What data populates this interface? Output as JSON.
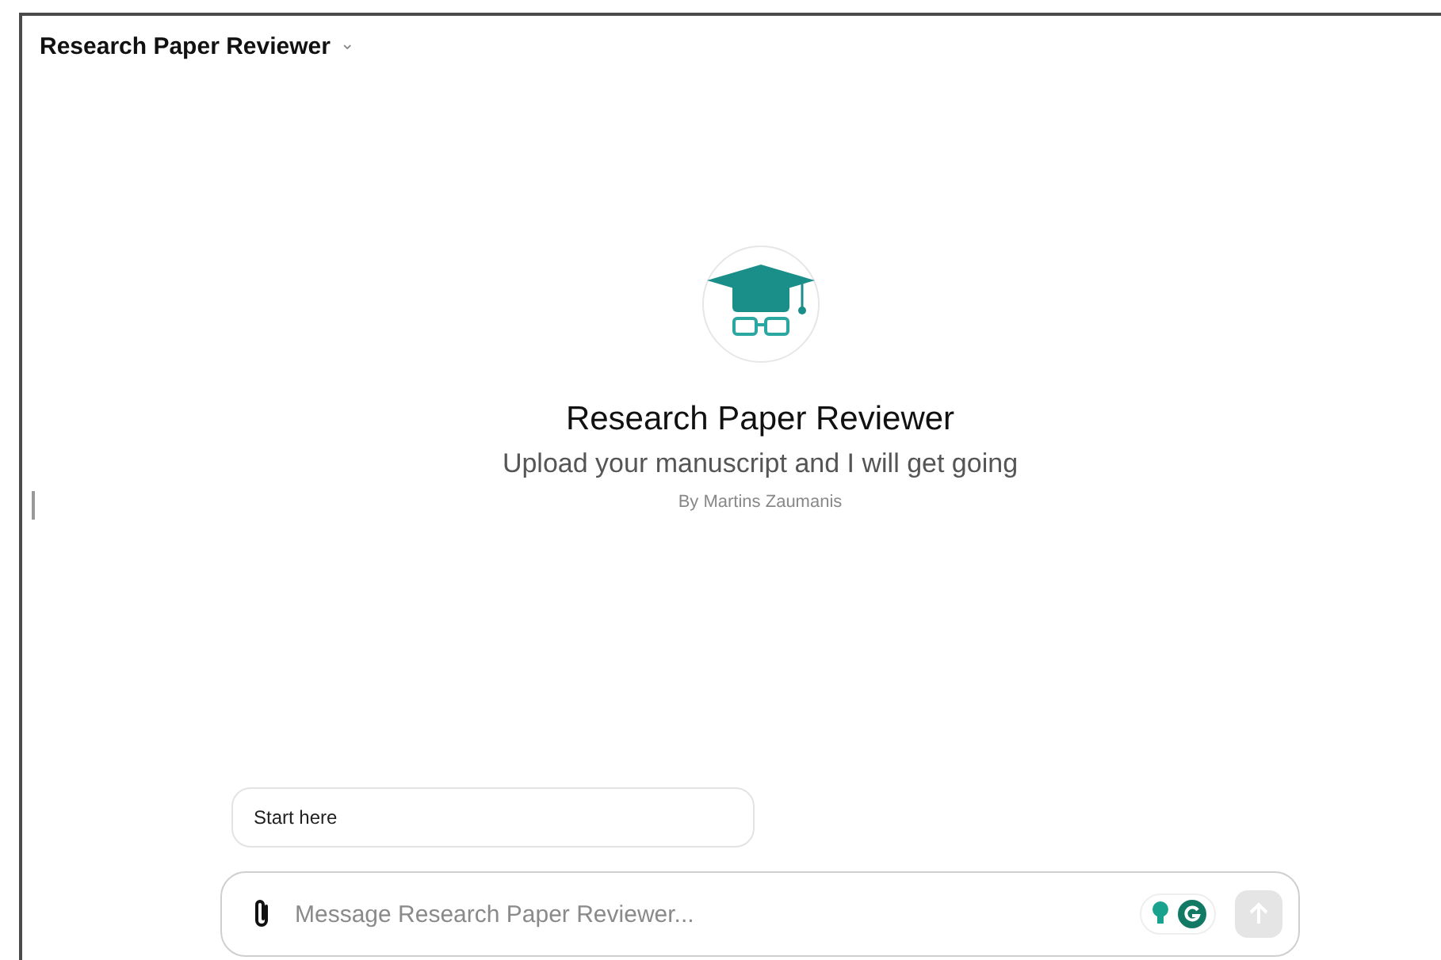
{
  "header": {
    "title": "Research Paper Reviewer",
    "caret": "⌄"
  },
  "profile": {
    "name": "Research Paper Reviewer",
    "description": "Upload your manuscript and I will get going",
    "author": "By Martins Zaumanis"
  },
  "suggestions": [
    "Start here"
  ],
  "composer": {
    "placeholder": "Message Research Paper Reviewer...",
    "send_disabled": true
  }
}
